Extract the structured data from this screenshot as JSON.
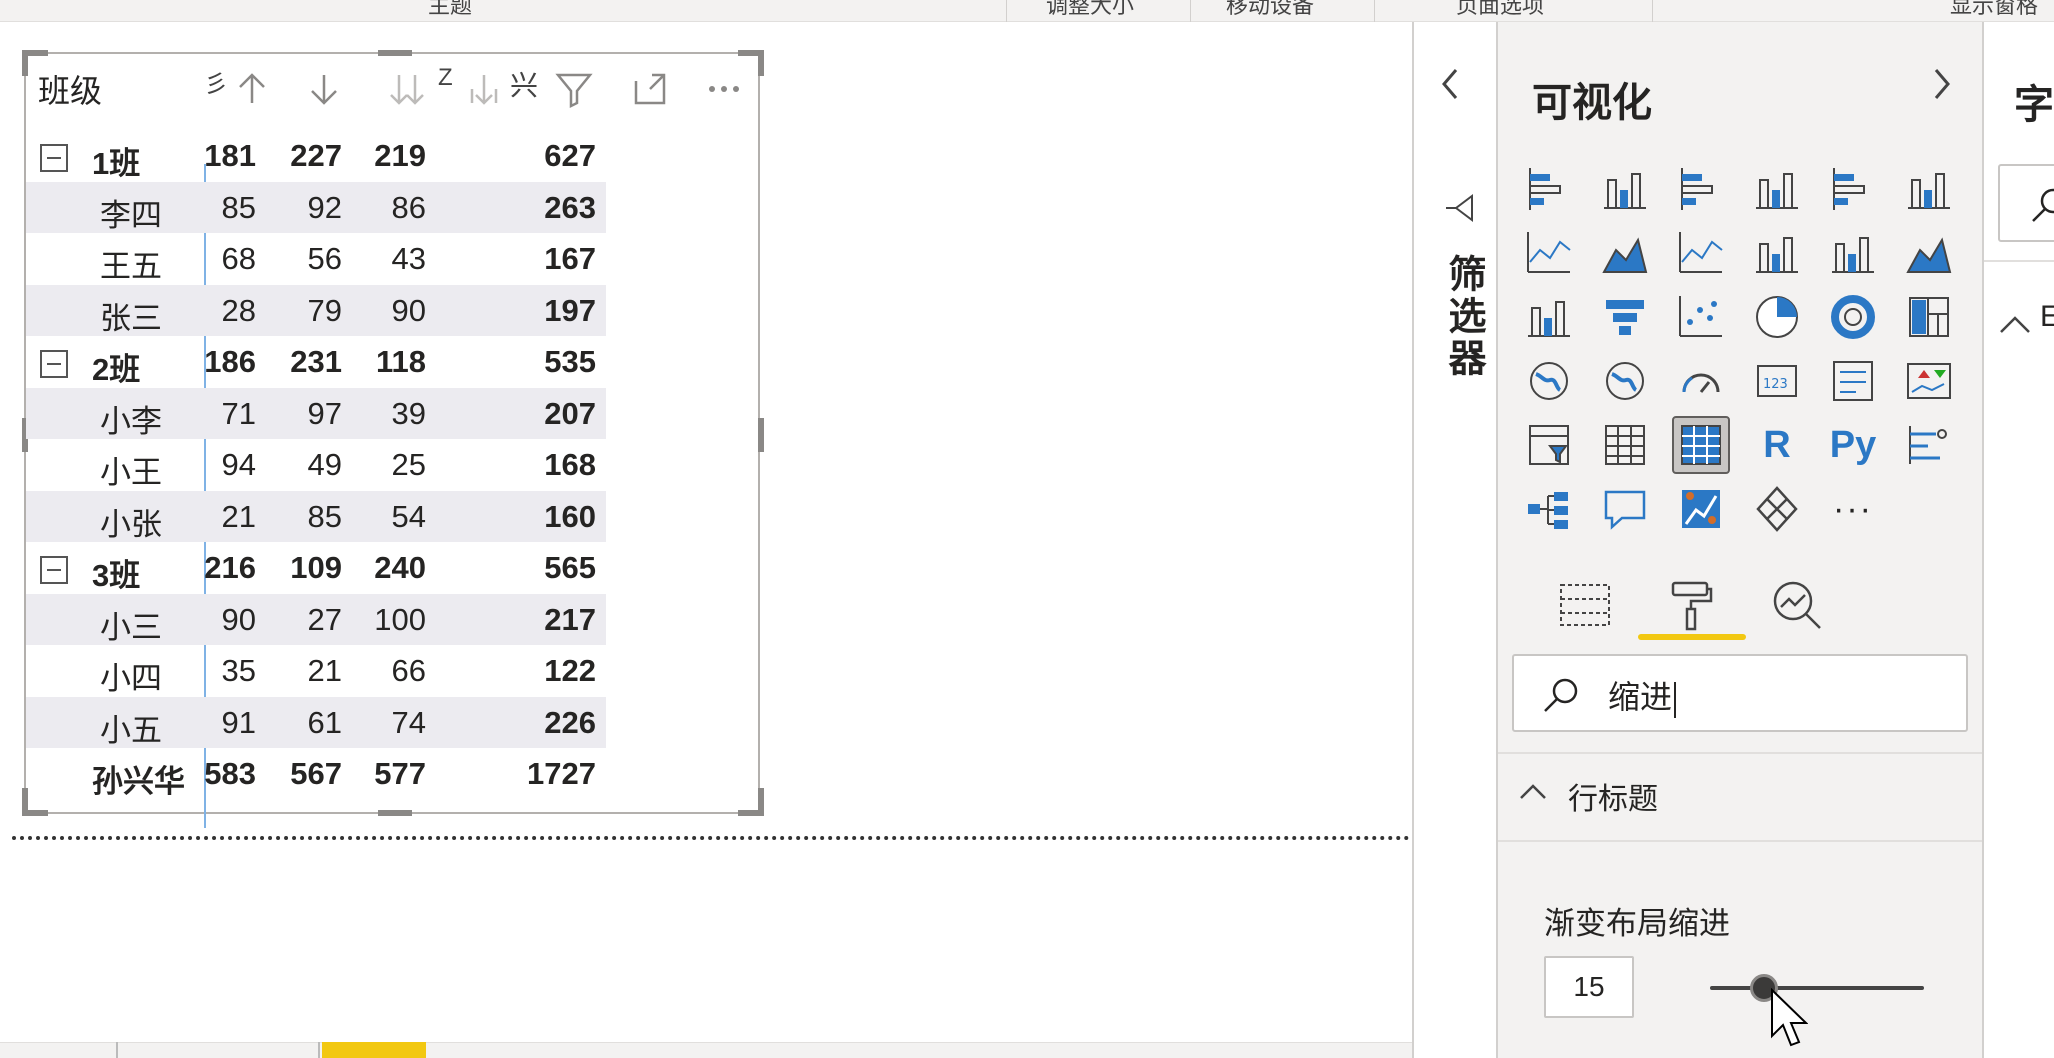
{
  "ribbon": {
    "items": [
      "主题",
      "调整大小",
      "移动设备",
      "页面选项",
      "显示窗格"
    ]
  },
  "matrix": {
    "header_label": "班级",
    "header_fragments": [
      "彡",
      "Z",
      "兴"
    ],
    "rows": [
      {
        "kind": "group",
        "name": "1班",
        "v1": "181",
        "v2": "227",
        "v3": "219",
        "total": "627",
        "shaded": false
      },
      {
        "kind": "child",
        "name": "李四",
        "v1": "85",
        "v2": "92",
        "v3": "86",
        "total": "263",
        "shaded": true
      },
      {
        "kind": "child",
        "name": "王五",
        "v1": "68",
        "v2": "56",
        "v3": "43",
        "total": "167",
        "shaded": false
      },
      {
        "kind": "child",
        "name": "张三",
        "v1": "28",
        "v2": "79",
        "v3": "90",
        "total": "197",
        "shaded": true
      },
      {
        "kind": "group",
        "name": "2班",
        "v1": "186",
        "v2": "231",
        "v3": "118",
        "total": "535",
        "shaded": false
      },
      {
        "kind": "child",
        "name": "小李",
        "v1": "71",
        "v2": "97",
        "v3": "39",
        "total": "207",
        "shaded": true
      },
      {
        "kind": "child",
        "name": "小王",
        "v1": "94",
        "v2": "49",
        "v3": "25",
        "total": "168",
        "shaded": false
      },
      {
        "kind": "child",
        "name": "小张",
        "v1": "21",
        "v2": "85",
        "v3": "54",
        "total": "160",
        "shaded": true
      },
      {
        "kind": "group",
        "name": "3班",
        "v1": "216",
        "v2": "109",
        "v3": "240",
        "total": "565",
        "shaded": false
      },
      {
        "kind": "child",
        "name": "小三",
        "v1": "90",
        "v2": "27",
        "v3": "100",
        "total": "217",
        "shaded": true
      },
      {
        "kind": "child",
        "name": "小四",
        "v1": "35",
        "v2": "21",
        "v3": "66",
        "total": "122",
        "shaded": false
      },
      {
        "kind": "child",
        "name": "小五",
        "v1": "91",
        "v2": "61",
        "v3": "74",
        "total": "226",
        "shaded": true
      },
      {
        "kind": "total",
        "name": "孙兴华",
        "v1": "583",
        "v2": "567",
        "v3": "577",
        "total": "1727",
        "shaded": false
      }
    ]
  },
  "filters": {
    "label": "筛选器"
  },
  "visualizations": {
    "title": "可视化",
    "icons": [
      "stacked-bar-chart-icon",
      "stacked-column-chart-icon",
      "clustered-bar-chart-icon",
      "clustered-column-chart-icon",
      "100-stacked-bar-chart-icon",
      "100-stacked-column-chart-icon",
      "line-chart-icon",
      "area-chart-icon",
      "stacked-area-chart-icon",
      "line-clustered-column-chart-icon",
      "line-stacked-column-chart-icon",
      "ribbon-chart-icon",
      "waterfall-chart-icon",
      "funnel-chart-icon",
      "scatter-chart-icon",
      "pie-chart-icon",
      "donut-chart-icon",
      "treemap-icon",
      "map-icon",
      "filled-map-icon",
      "gauge-icon",
      "card-icon",
      "multi-row-card-icon",
      "kpi-icon",
      "slicer-icon",
      "table-icon",
      "matrix-icon",
      "r-visual-icon",
      "python-visual-icon",
      "key-influencers-icon",
      "decomposition-tree-icon",
      "qa-icon",
      "smart-narrative-icon",
      "power-apps-icon",
      "more-visuals-icon"
    ],
    "r_label": "R",
    "py_label": "Py",
    "more_label": "···",
    "search": {
      "value": "缩进"
    },
    "section_title": "行标题",
    "property_label": "渐变布局缩进",
    "indent_value": "15",
    "slider_fraction": 0.25
  },
  "fields": {
    "title_fragment": "字",
    "section_fragment": "E"
  },
  "colors": {
    "accent_yellow": "#f2c811",
    "visual_blue": "#2b78c5",
    "row_shade": "#ecebf0"
  }
}
